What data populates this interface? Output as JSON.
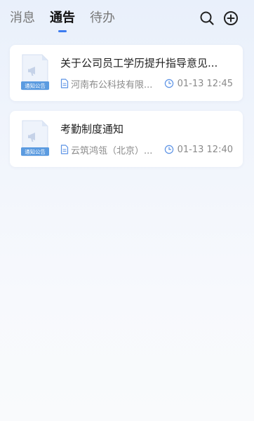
{
  "tabs": [
    {
      "label": "消息",
      "active": false
    },
    {
      "label": "通告",
      "active": true
    },
    {
      "label": "待办",
      "active": false
    }
  ],
  "icons": {
    "search": "search-icon",
    "add": "add-circle-icon",
    "doc": "notice-document-icon",
    "file": "file-icon",
    "clock": "clock-icon"
  },
  "colors": {
    "accent": "#3d7cf0",
    "badge": "#5b9be0",
    "meta_icon": "#5b92e5"
  },
  "notices": [
    {
      "badge": "通知公告",
      "title": "关于公司员工学历提升指导意见...",
      "company": "河南布公科技有限...",
      "time": "01-13 12:45"
    },
    {
      "badge": "通知公告",
      "title": "考勤制度通知",
      "company": "云筑鸿瓴（北京）...",
      "time": "01-13 12:40"
    }
  ]
}
